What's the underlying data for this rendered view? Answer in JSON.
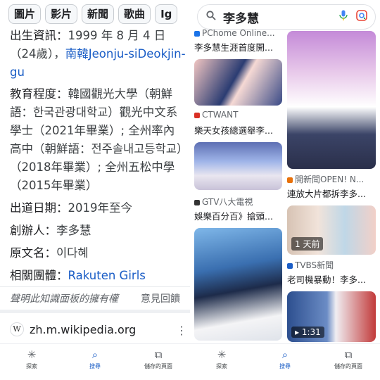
{
  "left": {
    "chips": [
      "圖片",
      "影片",
      "新聞",
      "歌曲",
      "Ig"
    ],
    "birth": {
      "key": "出生資訊：",
      "value": "1999 年 8 月 4 日（24歲），",
      "place": "南韓Jeonju-siDeokjin-gu"
    },
    "education": {
      "key": "教育程度：",
      "value": "韓國觀光大學（朝鮮語：한국관광대학교）觀光中文系學士（2021年畢業）; 全州率內高中（朝鮮語：전주솔내고등학교）（2018年畢業）; 全州五松中學（2015年畢業）"
    },
    "debut": {
      "key": "出道日期：",
      "value": "2019年至今"
    },
    "founder": {
      "key": "創辦人：",
      "value": "李多慧"
    },
    "original_name": {
      "key": "原文名：",
      "value": "이다혜"
    },
    "group": {
      "key": "相關團體：",
      "value": "Rakuten Girls"
    },
    "claim": "聲明此知識面板的擁有權",
    "feedback": "意見回饋",
    "wiki": {
      "logo": "W",
      "url": "zh.m.wikipedia.org",
      "menu": "⋮"
    }
  },
  "nav": [
    {
      "icon": "✳",
      "label": "探索"
    },
    {
      "icon": "⌕",
      "label": "搜尋"
    },
    {
      "icon": "⧉",
      "label": "儲存的頁面"
    }
  ],
  "right": {
    "search": {
      "icon": "🔍",
      "query": "李多慧",
      "mic": "🎤",
      "lens": "◉"
    },
    "col1": [
      {
        "source": "PChome Online...",
        "caption": "李多慧生涯首度開..."
      },
      {
        "source": "CTWANT",
        "caption": "樂天女孩總選舉李..."
      },
      {
        "source": "GTV八大電視",
        "caption": "娛樂百分百》搶頭..."
      }
    ],
    "col2": [
      {
        "source": "開新聞OPEN! N...",
        "caption": "連放大片都拆李多..."
      },
      {
        "source": "TVBS新聞",
        "caption": "老司機暴動！李多...",
        "badge": "1 天前"
      },
      {
        "badge": "1:31"
      }
    ],
    "colors": {
      "ctwant": "#d93025",
      "tvbs": "#1a5dc6",
      "pchome": "#1a73e8",
      "gtv": "#333333",
      "opennews": "#e8710a"
    }
  }
}
